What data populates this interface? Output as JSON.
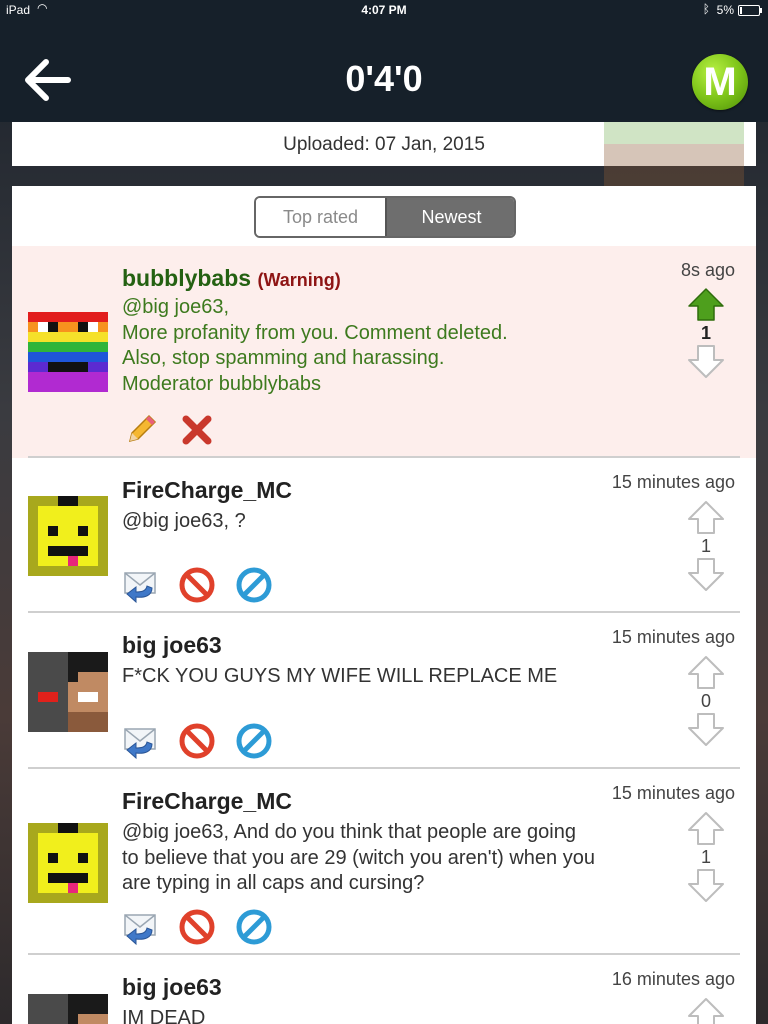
{
  "status_bar": {
    "device": "iPad",
    "time": "4:07 PM",
    "battery": "5%"
  },
  "header": {
    "title": "0'4'0",
    "logo_letter": "M"
  },
  "uploaded": "Uploaded: 07 Jan, 2015",
  "sort_tabs": {
    "top_rated": "Top rated",
    "newest": "Newest",
    "selected": "Newest"
  },
  "comments": [
    {
      "author": "bubblybabs",
      "tag": "(Warning)",
      "time": "8s ago",
      "lines": [
        "@big joe63,",
        "More profanity from you. Comment deleted.",
        "Also, stop spamming and harassing.",
        "Moderator bubblybabs"
      ],
      "score": "1",
      "upvoted": true,
      "actions": [
        "pencil-icon",
        "delete-icon"
      ]
    },
    {
      "author": "FireCharge_MC",
      "time": "15 minutes ago",
      "lines": [
        "@big joe63, ?"
      ],
      "score": "1",
      "actions": [
        "reply-icon",
        "report-icon",
        "block-icon"
      ]
    },
    {
      "author": "big joe63",
      "time": "15 minutes ago",
      "lines": [
        "F*CK YOU GUYS MY WIFE WILL REPLACE ME"
      ],
      "score": "0",
      "actions": [
        "reply-icon",
        "report-icon",
        "block-icon"
      ]
    },
    {
      "author": "FireCharge_MC",
      "time": "15 minutes ago",
      "lines": [
        "@big joe63, And do you think that people are going",
        "to believe that you are 29 (witch you aren't) when you",
        "are typing in all caps and cursing?"
      ],
      "score": "1",
      "actions": [
        "reply-icon",
        "report-icon",
        "block-icon"
      ]
    },
    {
      "author": "big joe63",
      "time": "16 minutes ago",
      "lines": [
        "IM DEAD"
      ]
    }
  ],
  "colors": {
    "nav_bg": "#16202a",
    "moderator_name": "#246112",
    "moderator_text": "#3d7a1e",
    "warning": "#8e1414",
    "highlight_bg": "#fdeeec",
    "upvote_active": "#4e9f1d",
    "segment_selected": "#6e6e6e"
  }
}
